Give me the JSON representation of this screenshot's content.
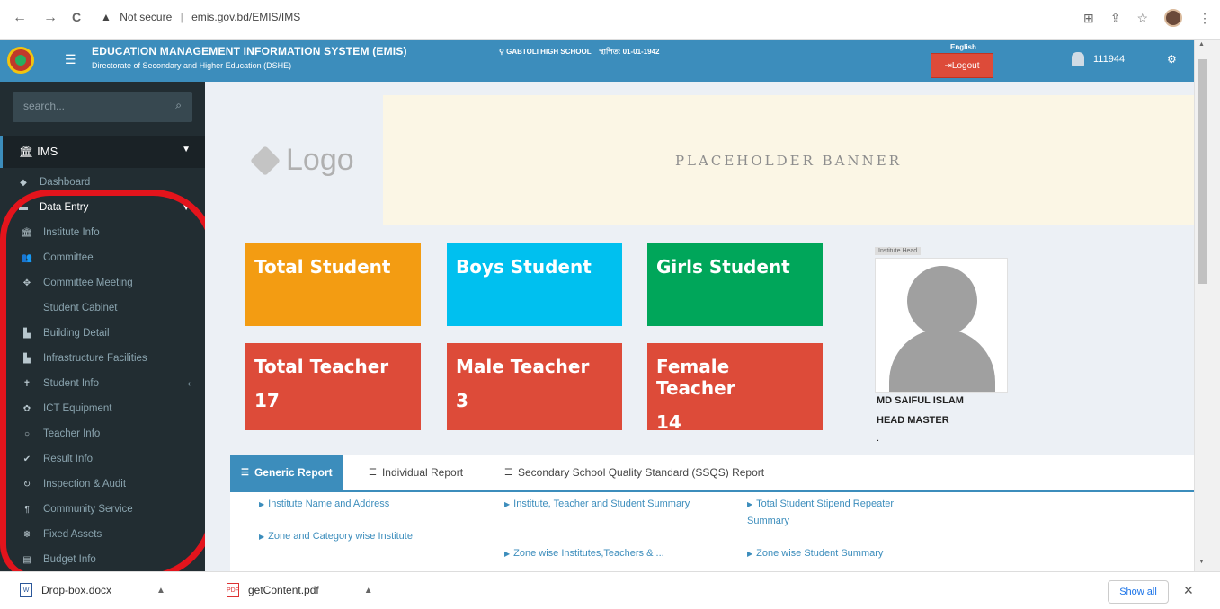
{
  "browser": {
    "back": "←",
    "forward": "→",
    "reload": "C",
    "security_label": "Not secure",
    "url": "emis.gov.bd/EMIS/IMS"
  },
  "header": {
    "title": "EDUCATION MANAGEMENT INFORMATION SYSTEM (EMIS)",
    "subtitle": "Directorate of Secondary and Higher Education (DSHE)",
    "school": "GABTOLI HIGH SCHOOL",
    "date": "স্থাপিত: 01-01-1942",
    "language": "English",
    "logout": "Logout",
    "user_id": "111944"
  },
  "sidebar": {
    "search_placeholder": "search...",
    "section": "IMS",
    "top_items": [
      "Dashboard",
      "Data Entry"
    ],
    "sub_items": [
      {
        "label": "Institute Info",
        "icon": "bank-icon"
      },
      {
        "label": "Committee",
        "icon": "users-icon"
      },
      {
        "label": "Committee Meeting",
        "icon": "handshake-icon"
      },
      {
        "label": "Student Cabinet",
        "icon": ""
      },
      {
        "label": "Building Detail",
        "icon": "bar-chart-icon"
      },
      {
        "label": "Infrastructure Facilities",
        "icon": "bar-chart-icon"
      },
      {
        "label": "Student Info",
        "icon": "student-icon"
      },
      {
        "label": "ICT Equipment",
        "icon": "gear-icon"
      },
      {
        "label": "Teacher Info",
        "icon": "circle-icon"
      },
      {
        "label": "Result Info",
        "icon": "check-icon"
      },
      {
        "label": "Inspection & Audit",
        "icon": "refresh-icon"
      },
      {
        "label": "Community Service",
        "icon": "community-icon"
      },
      {
        "label": "Fixed Assets",
        "icon": "assets-icon"
      },
      {
        "label": "Budget Info",
        "icon": "budget-icon"
      }
    ]
  },
  "main": {
    "logo_text": "Logo",
    "banner_text": "PLACEHOLDER BANNER",
    "stats": [
      {
        "label": "Total Student",
        "value": ""
      },
      {
        "label": "Boys Student",
        "value": ""
      },
      {
        "label": "Girls Student",
        "value": ""
      },
      {
        "label": "Total Teacher",
        "value": "17"
      },
      {
        "label": "Male Teacher",
        "value": "3"
      },
      {
        "label": "Female Teacher",
        "value": "14"
      }
    ],
    "head": {
      "tag": "Institute Head",
      "name": "MD SAIFUL ISLAM",
      "title": "HEAD MASTER",
      "extra": "."
    }
  },
  "reports": {
    "tabs": [
      "Generic Report",
      "Individual Report",
      "Secondary School Quality Standard (SSQS) Report"
    ],
    "links": [
      "Institute Name and Address",
      "Zone and Category wise Institute",
      "Institute, Teacher and Student Summary",
      "Zone wise Institutes,Teachers & ...",
      "Total Student Stipend Repeater Summary",
      "Zone wise Student Summary"
    ]
  },
  "downloads": {
    "item1": "Drop-box.docx",
    "item2": "getContent.pdf",
    "show_all": "Show all"
  },
  "colors": {
    "header": "#3c8dbc",
    "sidebar": "#222d32",
    "orange": "#f39c12",
    "aqua": "#00c0ef",
    "green": "#00a65a",
    "red": "#dd4b39"
  }
}
